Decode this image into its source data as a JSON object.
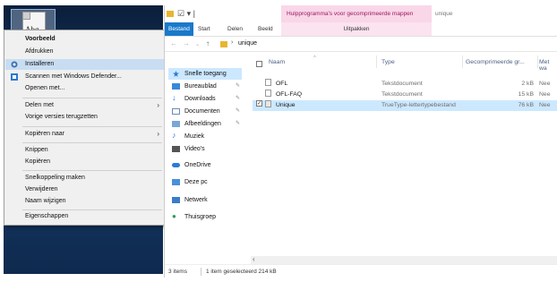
{
  "desktop": {
    "icon_label": "Abg"
  },
  "context_menu": {
    "items": [
      {
        "label": "Voorbeeld",
        "bold": true
      },
      {
        "label": "Afdrukken"
      },
      {
        "label": "Installeren",
        "icon": "shield-install-icon",
        "highlighted": true
      },
      {
        "label": "Scannen met Windows Defender...",
        "icon": "windows-defender-icon"
      },
      {
        "label": "Openen met..."
      },
      {
        "label": "Delen met",
        "submenu": true
      },
      {
        "label": "Vorige versies terugzetten"
      },
      {
        "label": "Kopiëren naar",
        "submenu": true
      },
      {
        "label": "Knippen"
      },
      {
        "label": "Kopiëren"
      },
      {
        "label": "Snelkoppeling maken"
      },
      {
        "label": "Verwijderen"
      },
      {
        "label": "Naam wijzigen"
      },
      {
        "label": "Eigenschappen"
      }
    ]
  },
  "explorer": {
    "context_tab_title": "Hulpprogramma's voor gecomprimeerde mappen",
    "window_title": "unique",
    "ribbon_tabs": [
      "Bestand",
      "Start",
      "Delen",
      "Beeld"
    ],
    "context_subtab": "Uitpakken",
    "address": {
      "path": "unique"
    },
    "nav_items": [
      {
        "label": "Snelle toegang",
        "icon": "star-icon",
        "selected": true
      },
      {
        "label": "Bureaublad",
        "icon": "desktop-folder-icon",
        "pinned": true
      },
      {
        "label": "Downloads",
        "icon": "download-icon",
        "pinned": true
      },
      {
        "label": "Documenten",
        "icon": "documents-icon",
        "pinned": true
      },
      {
        "label": "Afbeeldingen",
        "icon": "pictures-icon",
        "pinned": true
      },
      {
        "label": "Muziek",
        "icon": "music-icon"
      },
      {
        "label": "Video's",
        "icon": "video-icon"
      },
      {
        "label": "OneDrive",
        "icon": "onedrive-icon"
      },
      {
        "label": "Deze pc",
        "icon": "this-pc-icon"
      },
      {
        "label": "Netwerk",
        "icon": "network-icon"
      },
      {
        "label": "Thuisgroep",
        "icon": "homegroup-icon"
      }
    ],
    "columns": [
      "Naam",
      "Type",
      "Gecomprimeerde gr...",
      "Met wa"
    ],
    "files": [
      {
        "name": "OFL",
        "type": "Tekstdocument",
        "size": "2 kB",
        "password": "Nee"
      },
      {
        "name": "OFL-FAQ",
        "type": "Tekstdocument",
        "size": "15 kB",
        "password": "Nee"
      },
      {
        "name": "Unique",
        "type": "TrueType-lettertypebestand",
        "size": "76 kB",
        "password": "Nee",
        "selected": true
      }
    ],
    "status": {
      "count": "3 items",
      "selection": "1 item geselecteerd  214 kB"
    }
  },
  "colors": {
    "accent": "#1979ca",
    "selection": "#cce8ff",
    "context_tab": "#f9d6e8"
  }
}
